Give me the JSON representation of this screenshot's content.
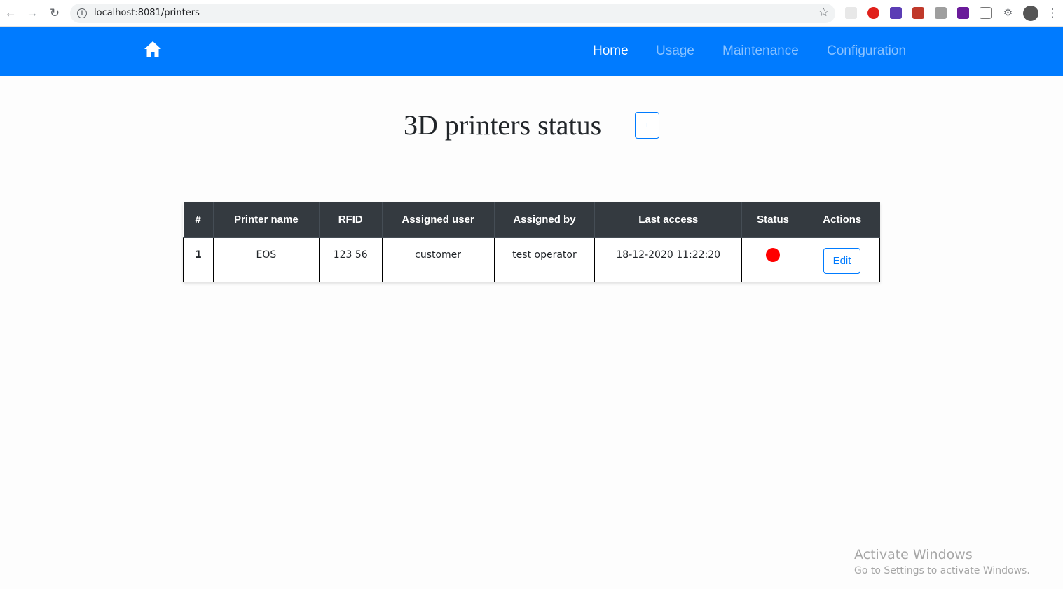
{
  "browser": {
    "url": "localhost:8081/printers"
  },
  "navbar": {
    "brand_color": "#007bff",
    "links": [
      {
        "label": "Home",
        "active": true
      },
      {
        "label": "Usage",
        "active": false
      },
      {
        "label": "Maintenance",
        "active": false
      },
      {
        "label": "Configuration",
        "active": false
      }
    ]
  },
  "page": {
    "title": "3D printers status",
    "add_button_label": "+"
  },
  "table": {
    "headers": [
      "#",
      "Printer name",
      "RFID",
      "Assigned user",
      "Assigned by",
      "Last access",
      "Status",
      "Actions"
    ],
    "rows": [
      {
        "num": "1",
        "printer_name": "EOS",
        "rfid": "123 56",
        "assigned_user": "customer",
        "assigned_by": "test operator",
        "last_access": "18-12-2020 11:22:20",
        "status_color": "#ff0000",
        "action_label": "Edit"
      }
    ]
  },
  "watermark": {
    "line1": "Activate Windows",
    "line2": "Go to Settings to activate Windows."
  }
}
